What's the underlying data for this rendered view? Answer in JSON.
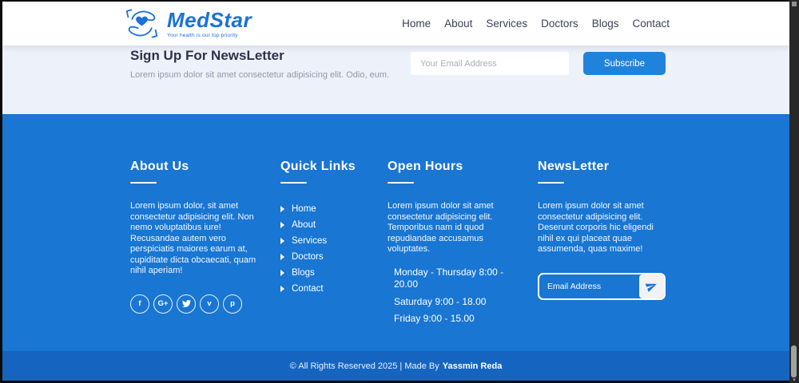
{
  "header": {
    "logo_name": "MedStar",
    "logo_tagline": "Your health is our top priority",
    "nav": [
      "Home",
      "About",
      "Services",
      "Doctors",
      "Blogs",
      "Contact"
    ]
  },
  "signup": {
    "title": "Sign Up For NewsLetter",
    "subtitle": "Lorem ipsum dolor sit amet consectetur adipisicing elit. Odio, eum.",
    "email_placeholder": "Your Email Address",
    "subscribe_label": "Subscribe"
  },
  "footer": {
    "about": {
      "title": "About Us",
      "text": "Lorem ipsum dolor, sit amet consectetur adipisicing elit. Non nemo voluptatibus iure! Recusandae autem vero perspiciatis maiores earum at, cupiditate dicta obcaecati, quam nihil aperiam!",
      "social": [
        {
          "name": "facebook",
          "glyph": "f"
        },
        {
          "name": "google-plus",
          "glyph": "G+"
        },
        {
          "name": "twitter",
          "glyph": ""
        },
        {
          "name": "vimeo",
          "glyph": "v"
        },
        {
          "name": "pinterest",
          "glyph": "p"
        }
      ]
    },
    "quick_links": {
      "title": "Quick Links",
      "links": [
        "Home",
        "About",
        "Services",
        "Doctors",
        "Blogs",
        "Contact"
      ]
    },
    "open_hours": {
      "title": "Open Hours",
      "text": "Lorem ipsum dolor sit amet consectetur adipisicing elit. Temporibus nam id quod repudiandae accusamus voluptates.",
      "hours": [
        "Monday - Thursday 8:00 - 20.00",
        "Saturday 9:00 - 18.00",
        "Friday 9:00 - 15.00"
      ]
    },
    "newsletter": {
      "title": "NewsLetter",
      "text": "Lorem ipsum dolor sit amet consectetur adipisicing elit. Deserunt corporis hic eligendi nihil ex qui placeat quae assumenda, quas maxime!",
      "email_placeholder": "Email Address"
    }
  },
  "bottom_bar": {
    "copyright": "© All Rights Reserved 2025 | Made By",
    "author": "Yassmin Reda"
  },
  "colors": {
    "primary": "#1976d2",
    "footer_bottom": "#1565c0",
    "light_section": "#edf1fa",
    "logo_blue": "#1a71d8"
  }
}
